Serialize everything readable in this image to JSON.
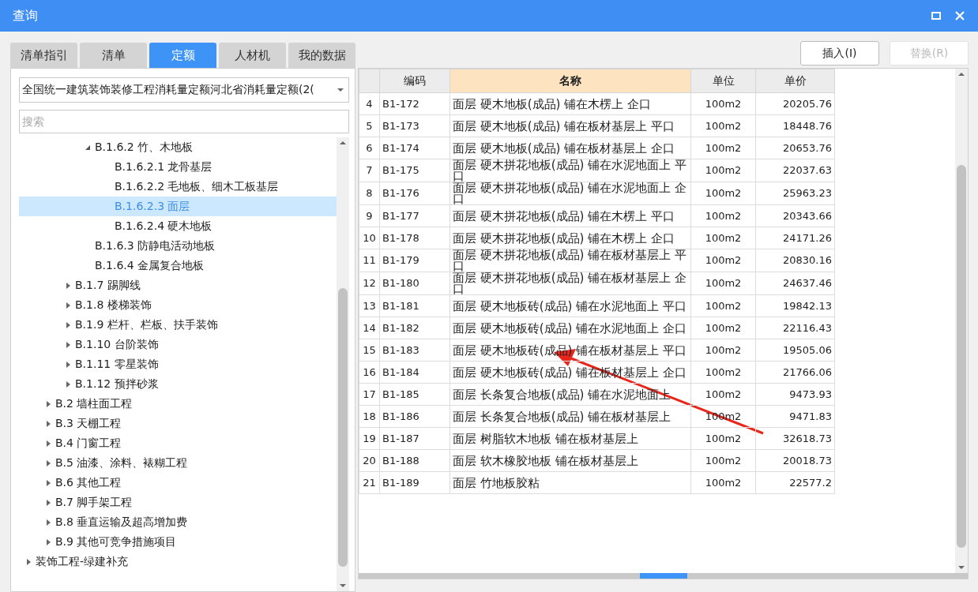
{
  "window": {
    "title": "查询"
  },
  "tabs": [
    {
      "label": "清单指引",
      "selected": false
    },
    {
      "label": "清单",
      "selected": false
    },
    {
      "label": "定额",
      "selected": true
    },
    {
      "label": "人材机",
      "selected": false
    },
    {
      "label": "我的数据",
      "selected": false
    }
  ],
  "buttons": [
    {
      "label": "插入(I)",
      "disabled": false
    },
    {
      "label": "替换(R)",
      "disabled": true
    }
  ],
  "library_select": {
    "value": "全国统一建筑装饰装修工程消耗量定额河北省消耗量定额(2("
  },
  "search": {
    "placeholder": "搜索"
  },
  "tree": {
    "items": [
      {
        "children": [
          {
            "children": [
              {
                "children": [
                  {
                    "label": "B.1.6.2 竹、木地板",
                    "expanded": true,
                    "selected": false,
                    "children": [
                      {
                        "label": "B.1.6.2.1 龙骨基层",
                        "selected": false
                      },
                      {
                        "label": "B.1.6.2.2 毛地板、细木工板基层",
                        "selected": false
                      },
                      {
                        "label": "B.1.6.2.3 面层",
                        "selected": true
                      },
                      {
                        "label": "B.1.6.2.4 硬木地板",
                        "selected": false
                      }
                    ]
                  },
                  {
                    "label": "B.1.6.3 防静电活动地板",
                    "selected": false
                  },
                  {
                    "label": "B.1.6.4 金属复合地板",
                    "selected": false
                  }
                ]
              },
              {
                "label": "B.1.7 踢脚线",
                "expanded": false,
                "selected": false
              },
              {
                "label": "B.1.8 楼梯装饰",
                "expanded": false,
                "selected": false
              },
              {
                "label": "B.1.9 栏杆、栏板、扶手装饰",
                "expanded": false,
                "selected": false
              },
              {
                "label": "B.1.10 台阶装饰",
                "expanded": false,
                "selected": false
              },
              {
                "label": "B.1.11 零星装饰",
                "expanded": false,
                "selected": false
              },
              {
                "label": "B.1.12 预拌砂浆",
                "expanded": false,
                "selected": false
              }
            ]
          },
          {
            "label": "B.2 墙柱面工程",
            "expanded": false,
            "selected": false
          },
          {
            "label": "B.3 天棚工程",
            "expanded": false,
            "selected": false
          },
          {
            "label": "B.4 门窗工程",
            "expanded": false,
            "selected": false
          },
          {
            "label": "B.5 油漆、涂料、裱糊工程",
            "expanded": false,
            "selected": false
          },
          {
            "label": "B.6 其他工程",
            "expanded": false,
            "selected": false
          },
          {
            "label": "B.7 脚手架工程",
            "expanded": false,
            "selected": false
          },
          {
            "label": "B.8 垂直运输及超高增加费",
            "expanded": false,
            "selected": false
          },
          {
            "label": "B.9 其他可竞争措施项目",
            "expanded": false,
            "selected": false
          }
        ]
      },
      {
        "label": "装饰工程-绿建补充",
        "expanded": false,
        "selected": false
      }
    ]
  },
  "table": {
    "columns": [
      {
        "label": "编码",
        "sorted": false
      },
      {
        "label": "名称",
        "sorted": true
      },
      {
        "label": "单位",
        "sorted": false
      },
      {
        "label": "单价",
        "sorted": false
      }
    ],
    "rows": [
      {
        "num": "4",
        "code": "B1-172",
        "name": "面层 硬木地板(成品) 铺在木楞上 企口",
        "unit": "100m2",
        "price": "20205.76"
      },
      {
        "num": "5",
        "code": "B1-173",
        "name": "面层 硬木地板(成品) 铺在板材基层上 平口",
        "unit": "100m2",
        "price": "18448.76"
      },
      {
        "num": "6",
        "code": "B1-174",
        "name": "面层 硬木地板(成品) 铺在板材基层上 企口",
        "unit": "100m2",
        "price": "20653.76"
      },
      {
        "num": "7",
        "code": "B1-175",
        "name": "面层 硬木拼花地板(成品) 铺在水泥地面上 平口",
        "unit": "100m2",
        "price": "22037.63"
      },
      {
        "num": "8",
        "code": "B1-176",
        "name": "面层 硬木拼花地板(成品) 铺在水泥地面上 企口",
        "unit": "100m2",
        "price": "25963.23"
      },
      {
        "num": "9",
        "code": "B1-177",
        "name": "面层 硬木拼花地板(成品) 铺在木楞上 平口",
        "unit": "100m2",
        "price": "20343.66"
      },
      {
        "num": "10",
        "code": "B1-178",
        "name": "面层 硬木拼花地板(成品) 铺在木楞上 企口",
        "unit": "100m2",
        "price": "24171.26"
      },
      {
        "num": "11",
        "code": "B1-179",
        "name": "面层 硬木拼花地板(成品) 铺在板材基层上 平口",
        "unit": "100m2",
        "price": "20830.16"
      },
      {
        "num": "12",
        "code": "B1-180",
        "name": "面层 硬木拼花地板(成品) 铺在板材基层上 企口",
        "unit": "100m2",
        "price": "24637.46"
      },
      {
        "num": "13",
        "code": "B1-181",
        "name": "面层 硬木地板砖(成品) 铺在水泥地面上 平口",
        "unit": "100m2",
        "price": "19842.13"
      },
      {
        "num": "14",
        "code": "B1-182",
        "name": "面层 硬木地板砖(成品) 铺在水泥地面上 企口",
        "unit": "100m2",
        "price": "22116.43"
      },
      {
        "num": "15",
        "code": "B1-183",
        "name": "面层 硬木地板砖(成品) 铺在板材基层上 平口",
        "unit": "100m2",
        "price": "19505.06"
      },
      {
        "num": "16",
        "code": "B1-184",
        "name": "面层 硬木地板砖(成品) 铺在板材基层上 企口",
        "unit": "100m2",
        "price": "21766.06"
      },
      {
        "num": "17",
        "code": "B1-185",
        "name": "面层 长条复合地板(成品) 铺在水泥地面上",
        "unit": "100m2",
        "price": "9473.93"
      },
      {
        "num": "18",
        "code": "B1-186",
        "name": "面层 长条复合地板(成品) 铺在板材基层上",
        "unit": "100m2",
        "price": "9471.83"
      },
      {
        "num": "19",
        "code": "B1-187",
        "name": "面层 树脂软木地板 铺在板材基层上",
        "unit": "100m2",
        "price": "32618.73"
      },
      {
        "num": "20",
        "code": "B1-188",
        "name": "面层 软木橡胶地板 铺在板材基层上",
        "unit": "100m2",
        "price": "20018.73"
      },
      {
        "num": "21",
        "code": "B1-189",
        "name": "面层 竹地板胶粘",
        "unit": "100m2",
        "price": "22577.2"
      }
    ]
  }
}
